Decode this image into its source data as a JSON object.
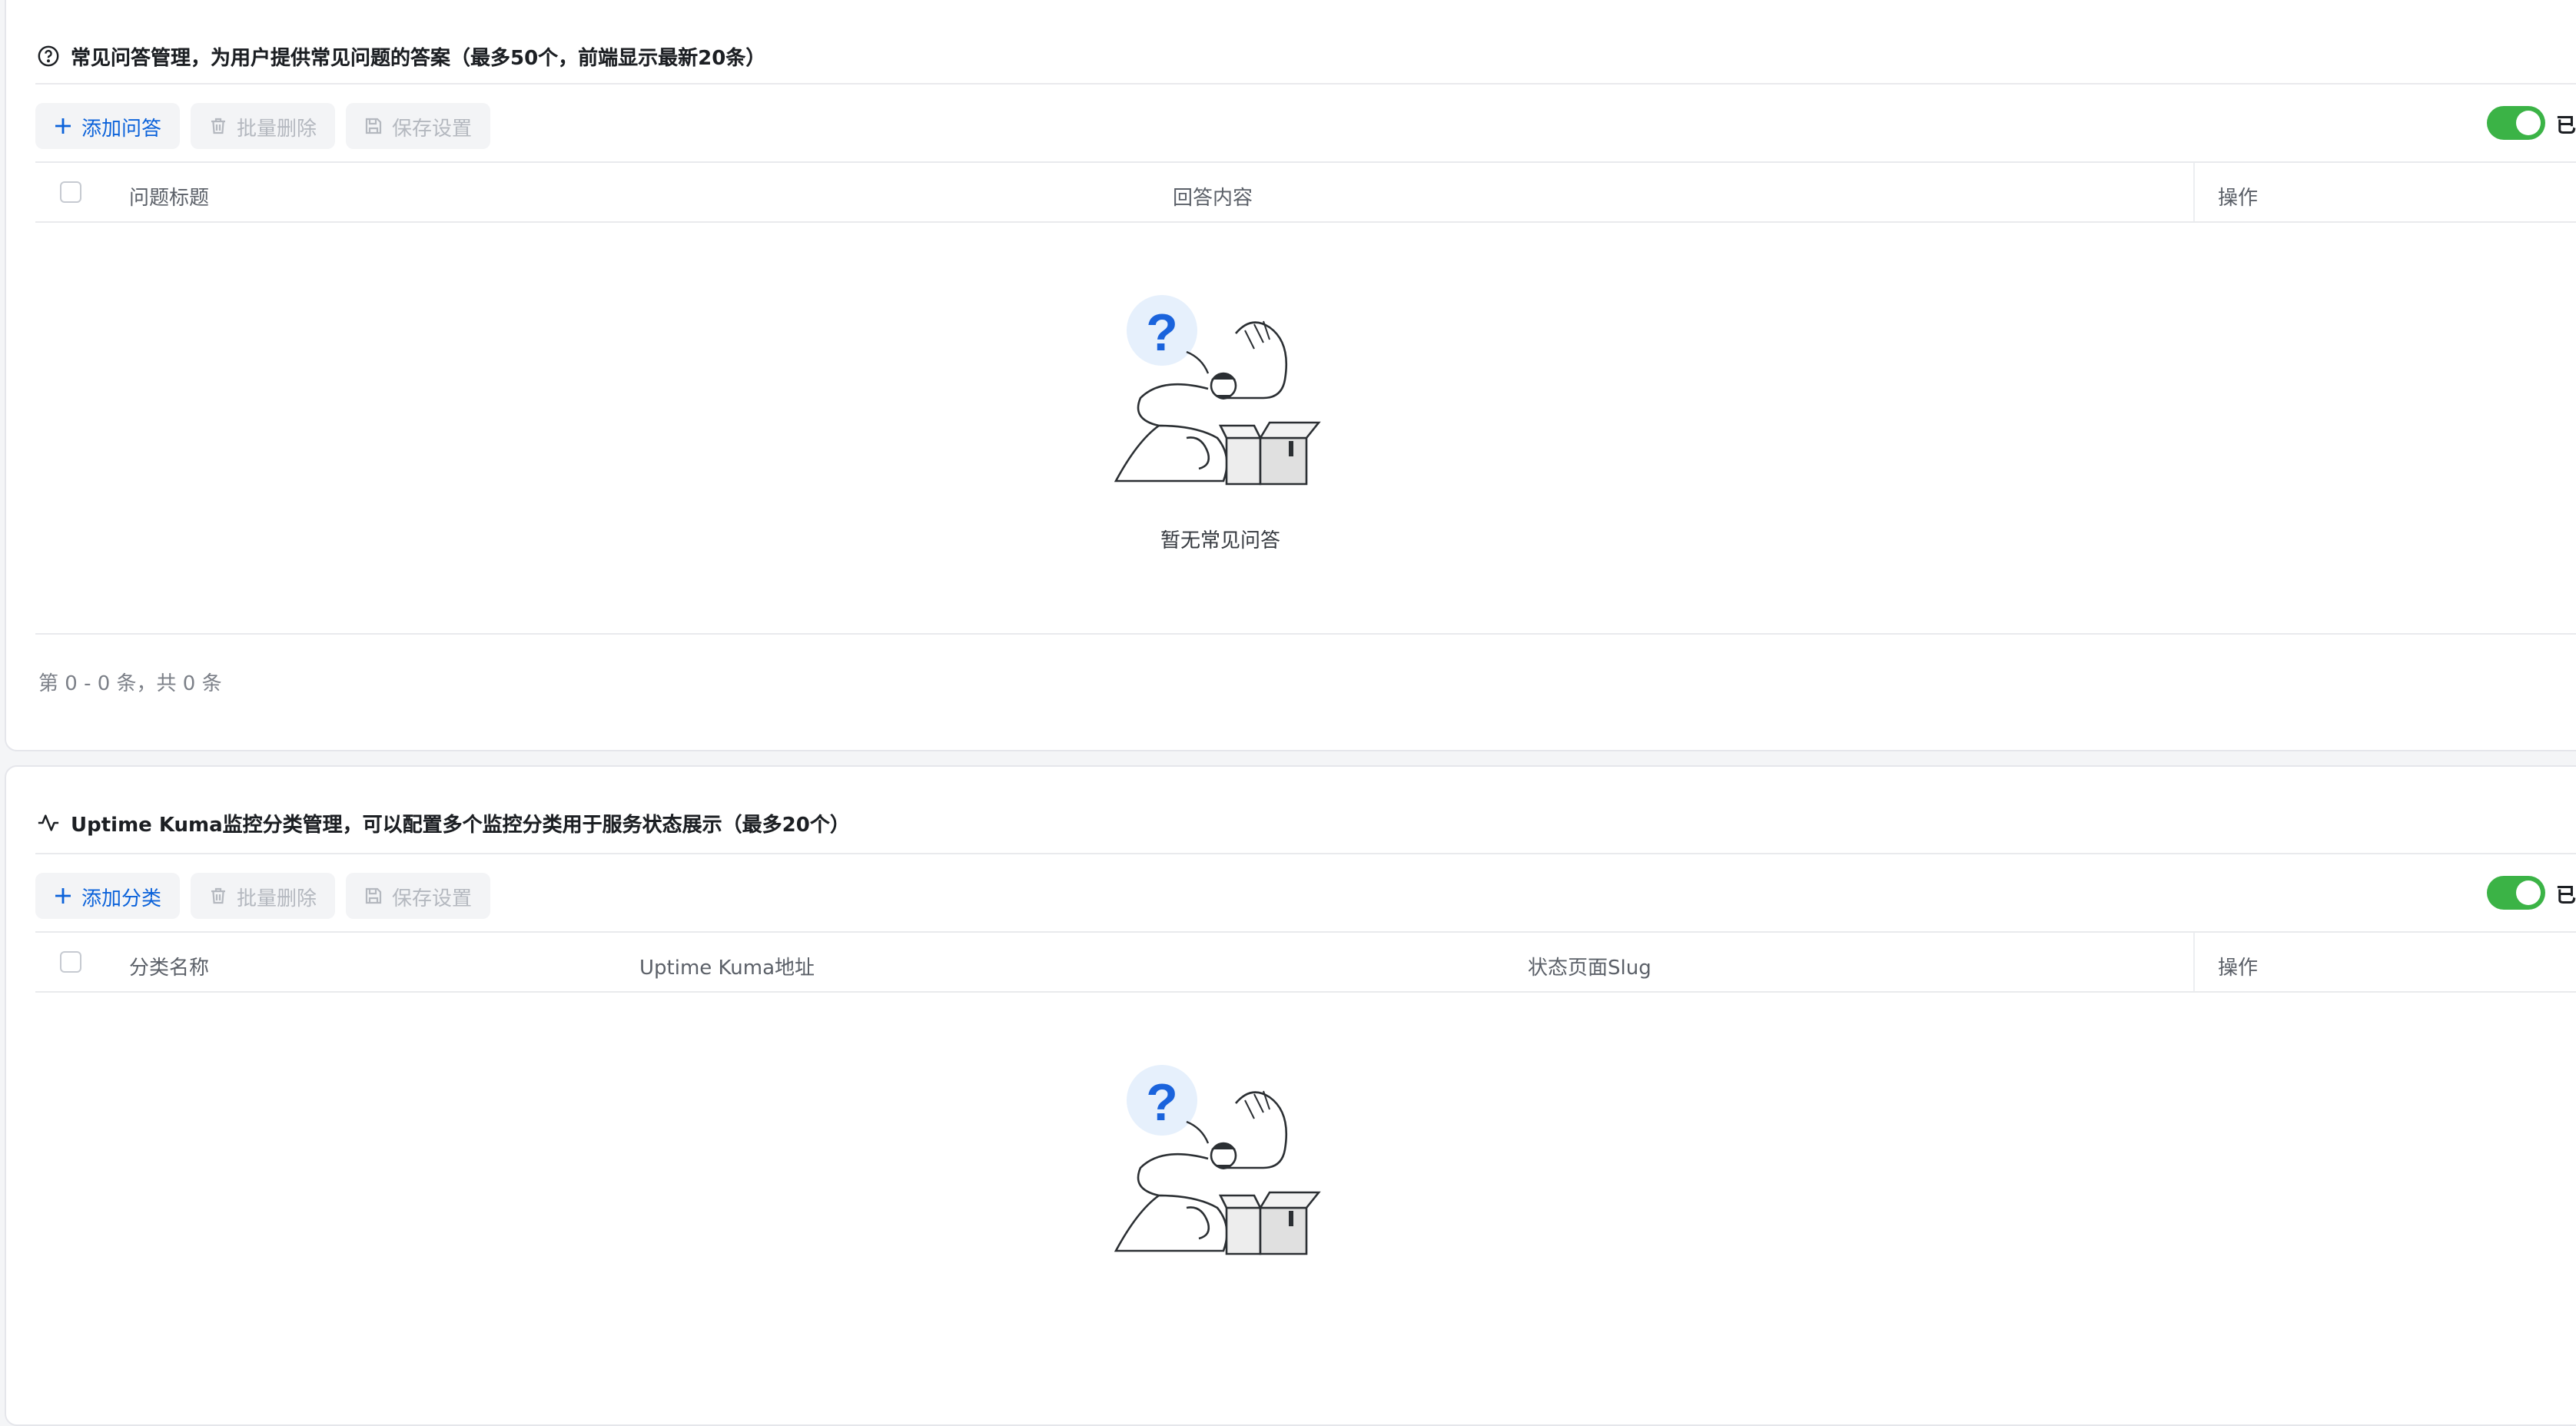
{
  "faq": {
    "title": "常见问答管理，为用户提供常见问题的答案（最多50个，前端显示最新20条）",
    "toolbar": {
      "add": "添加问答",
      "batch_delete": "批量删除",
      "save": "保存设置"
    },
    "toggle_label": "已启用",
    "columns": [
      "问题标题",
      "回答内容",
      "操作"
    ],
    "empty_text": "暂无常见问答",
    "pagination": "第 0 - 0 条，共 0 条"
  },
  "uptime": {
    "title": "Uptime Kuma监控分类管理，可以配置多个监控分类用于服务状态展示（最多20个）",
    "toolbar": {
      "add": "添加分类",
      "batch_delete": "批量删除",
      "save": "保存设置"
    },
    "toggle_label": "已启用",
    "columns": [
      "分类名称",
      "Uptime Kuma地址",
      "状态页面Slug",
      "操作"
    ]
  },
  "colors": {
    "primary": "#0b62da",
    "toggle_on": "#3bb346",
    "border": "#e5e6eb"
  },
  "icons": {
    "faq_header": "question-circle-icon",
    "uptime_header": "activity-icon",
    "add": "plus-icon",
    "delete": "trash-icon",
    "save": "save-icon",
    "empty": "empty-illustration"
  }
}
